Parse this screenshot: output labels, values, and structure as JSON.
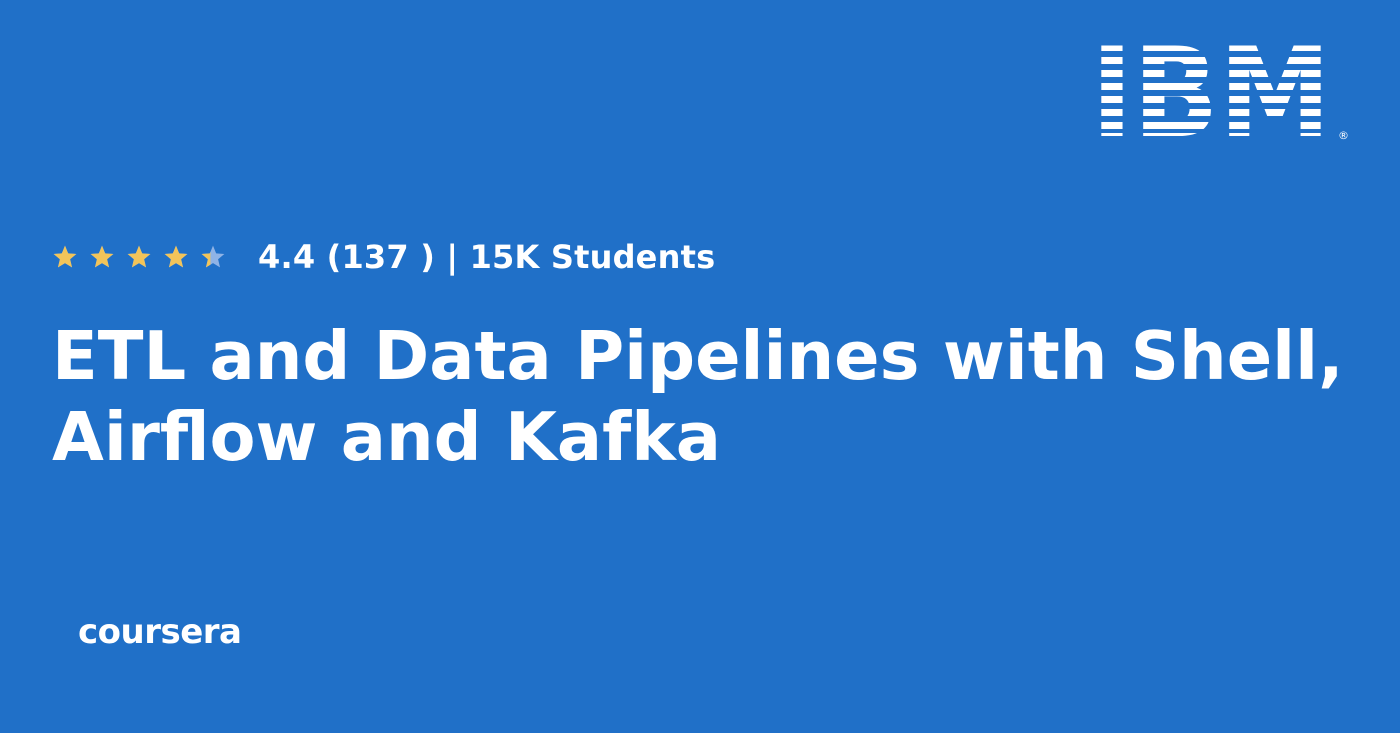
{
  "brand": {
    "partner_logo_text": "IBM",
    "platform_logo_text": "coursera"
  },
  "rating": {
    "value": 4.4,
    "max_stars": 5,
    "text": "4.4 (137 ) | 15K Students"
  },
  "course": {
    "title": "ETL and Data Pipelines with Shell, Airflow and Kafka"
  },
  "colors": {
    "background": "#2070c8",
    "star_filled": "#f2c45a",
    "star_empty": "#8fb3e6",
    "text": "#ffffff"
  },
  "icons": [
    "star-icon",
    "star-half-icon",
    "ibm-logo",
    "coursera-logo"
  ]
}
